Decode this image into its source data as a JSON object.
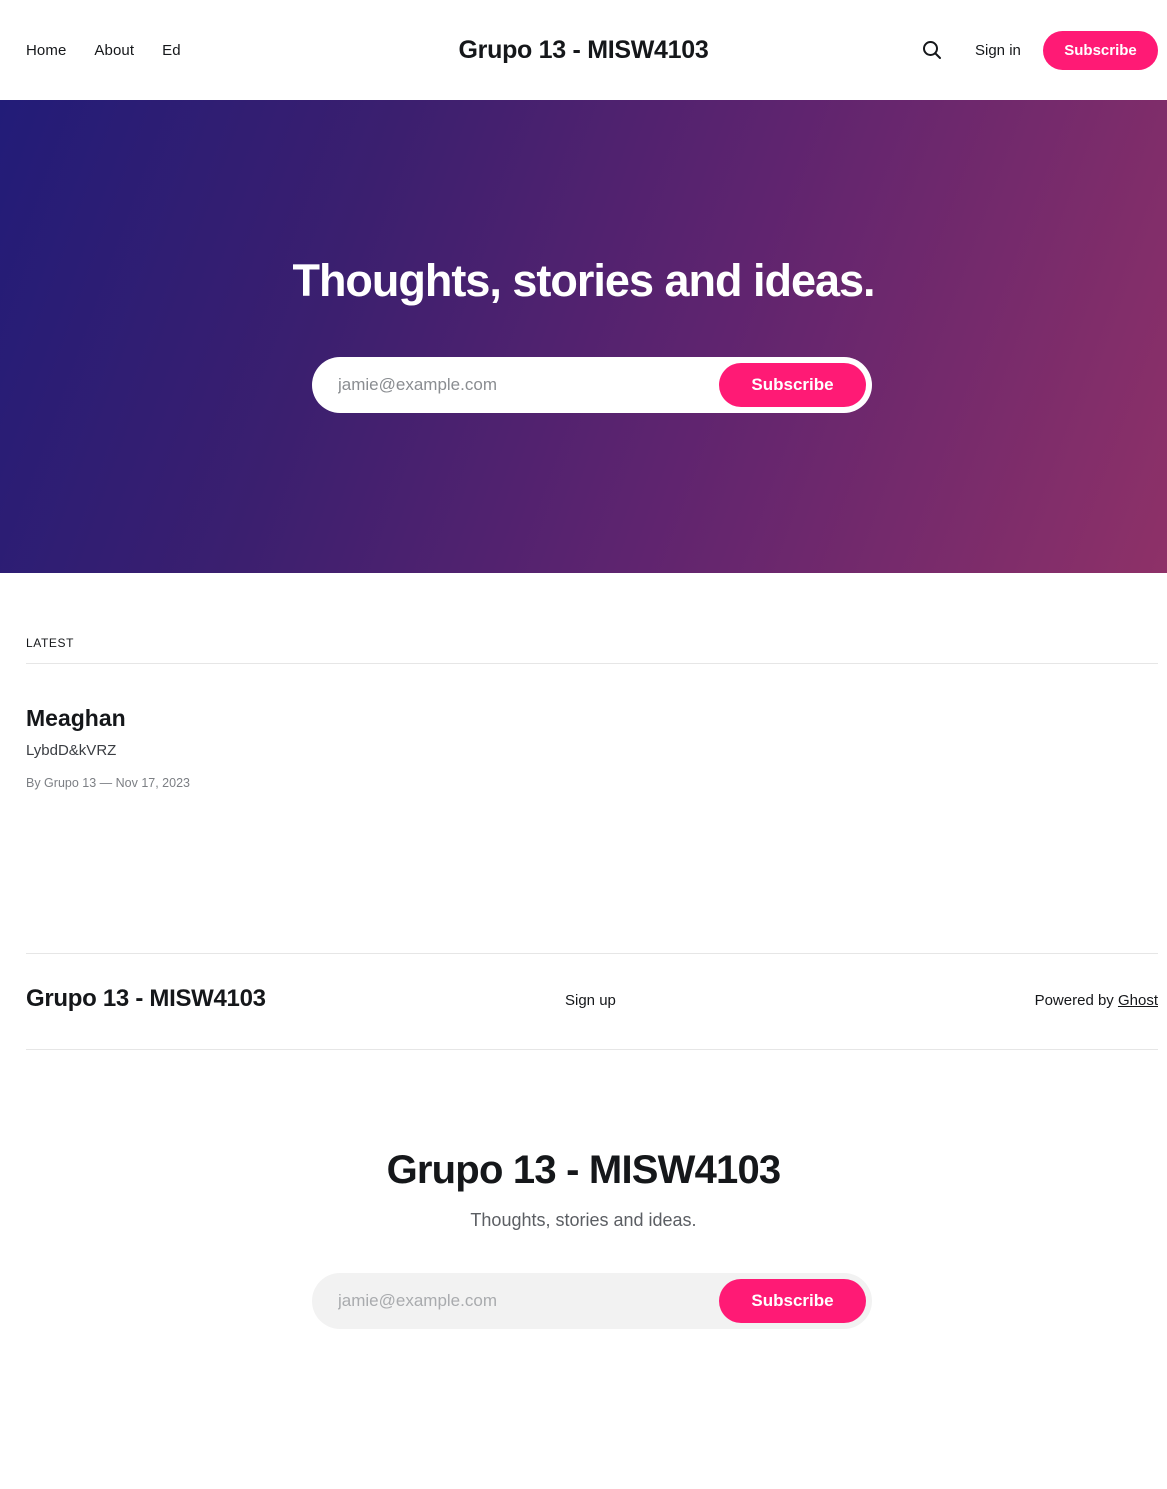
{
  "header": {
    "nav": [
      "Home",
      "About",
      "Ed"
    ],
    "site_title": "Grupo 13 - MISW4103",
    "search_icon": "search-icon",
    "signin_label": "Sign in",
    "subscribe_label": "Subscribe"
  },
  "hero": {
    "title": "Thoughts, stories and ideas.",
    "email_placeholder": "jamie@example.com",
    "subscribe_label": "Subscribe"
  },
  "latest": {
    "label": "LATEST",
    "post": {
      "title": "Meaghan",
      "excerpt": "LybdD&kVRZ",
      "meta": "By Grupo 13 — Nov 17, 2023"
    }
  },
  "footer": {
    "brand": "Grupo 13 - MISW4103",
    "signup_label": "Sign up",
    "powered_by": "Powered by",
    "ghost_link": "Ghost"
  },
  "cta": {
    "title": "Grupo 13 - MISW4103",
    "description": "Thoughts, stories and ideas.",
    "email_placeholder": "jamie@example.com",
    "subscribe_label": "Subscribe"
  },
  "colors": {
    "accent": "#ff1a75",
    "hero_gradient_start": "#221c78",
    "hero_gradient_end": "#8e3168"
  }
}
